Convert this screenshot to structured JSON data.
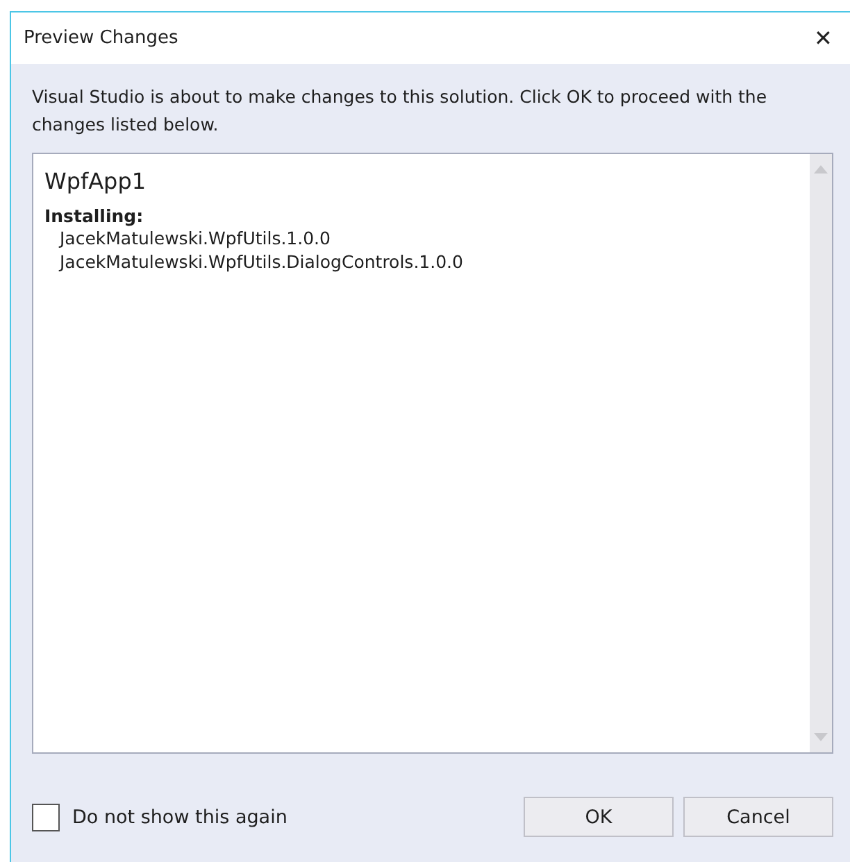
{
  "window": {
    "title": "Preview Changes",
    "close": "✕"
  },
  "message": "Visual Studio is about to make changes to this solution. Click OK to proceed with the changes listed below.",
  "changes": {
    "project": "WpfApp1",
    "heading": "Installing:",
    "packages": [
      "JacekMatulewski.WpfUtils.1.0.0",
      "JacekMatulewski.WpfUtils.DialogControls.1.0.0"
    ]
  },
  "checkbox": {
    "label": "Do not show this again",
    "checked": false
  },
  "buttons": [
    "OK",
    "Cancel"
  ]
}
